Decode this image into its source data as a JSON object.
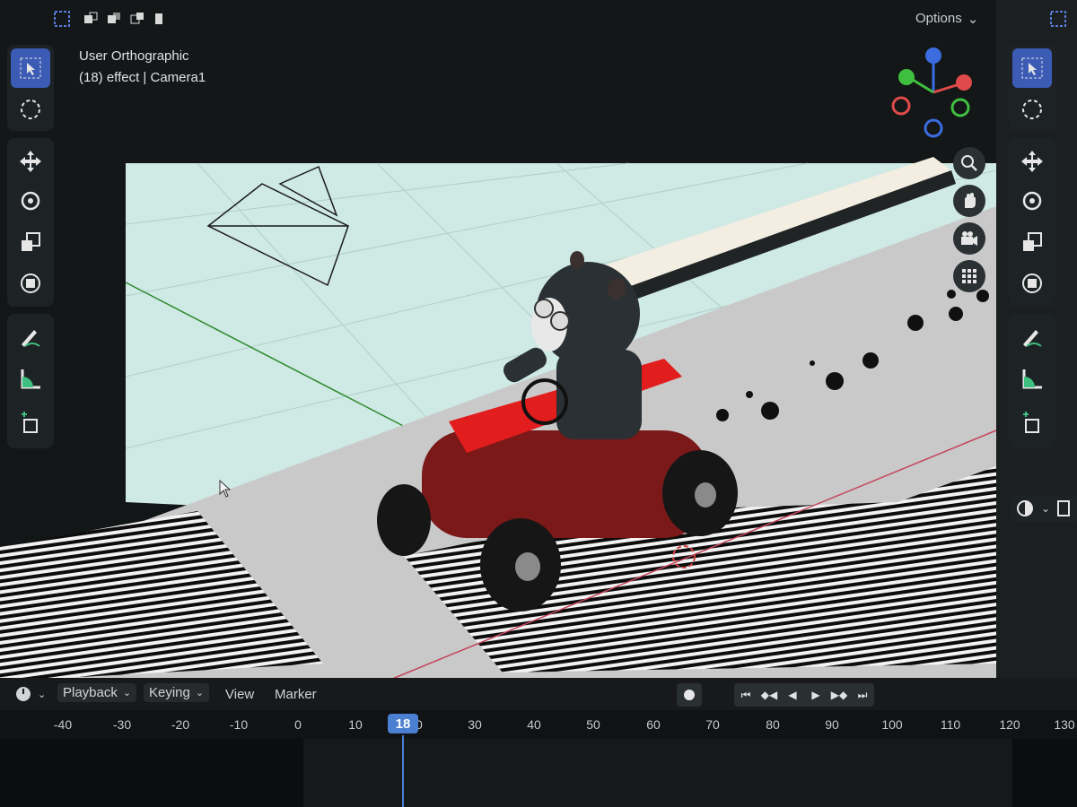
{
  "header": {
    "options_label": "Options"
  },
  "viewport": {
    "view_name": "User Orthographic",
    "object_info": "(18) effect | Camera1"
  },
  "left_toolbar": {
    "tools": [
      {
        "name": "select-box",
        "active": true
      },
      {
        "name": "cursor"
      },
      {
        "name": "move"
      },
      {
        "name": "rotate"
      },
      {
        "name": "scale"
      },
      {
        "name": "transform"
      },
      {
        "name": "annotate"
      },
      {
        "name": "measure"
      },
      {
        "name": "add-cube"
      }
    ]
  },
  "right_toolbar": {
    "tools": [
      {
        "name": "select-box",
        "active": true
      },
      {
        "name": "cursor"
      },
      {
        "name": "move"
      },
      {
        "name": "rotate"
      },
      {
        "name": "scale"
      },
      {
        "name": "transform"
      },
      {
        "name": "annotate"
      },
      {
        "name": "measure"
      },
      {
        "name": "add-cube"
      }
    ]
  },
  "navigation": {
    "buttons": [
      "zoom-icon",
      "hand-icon",
      "camera-icon",
      "grid-icon"
    ]
  },
  "timeline": {
    "menus": [
      "Playback",
      "Keying",
      "View",
      "Marker"
    ],
    "current_frame": "18",
    "ticks": [
      "-40",
      "-30",
      "-20",
      "-10",
      "0",
      "10",
      "20",
      "30",
      "40",
      "50",
      "60",
      "70",
      "80",
      "90",
      "100",
      "110",
      "120",
      "130"
    ]
  },
  "colors": {
    "accent": "#4a7fd1",
    "active_tool": "#3b5bb5",
    "car_body": "#7a1616",
    "car_highlight": "#e61d1d"
  }
}
